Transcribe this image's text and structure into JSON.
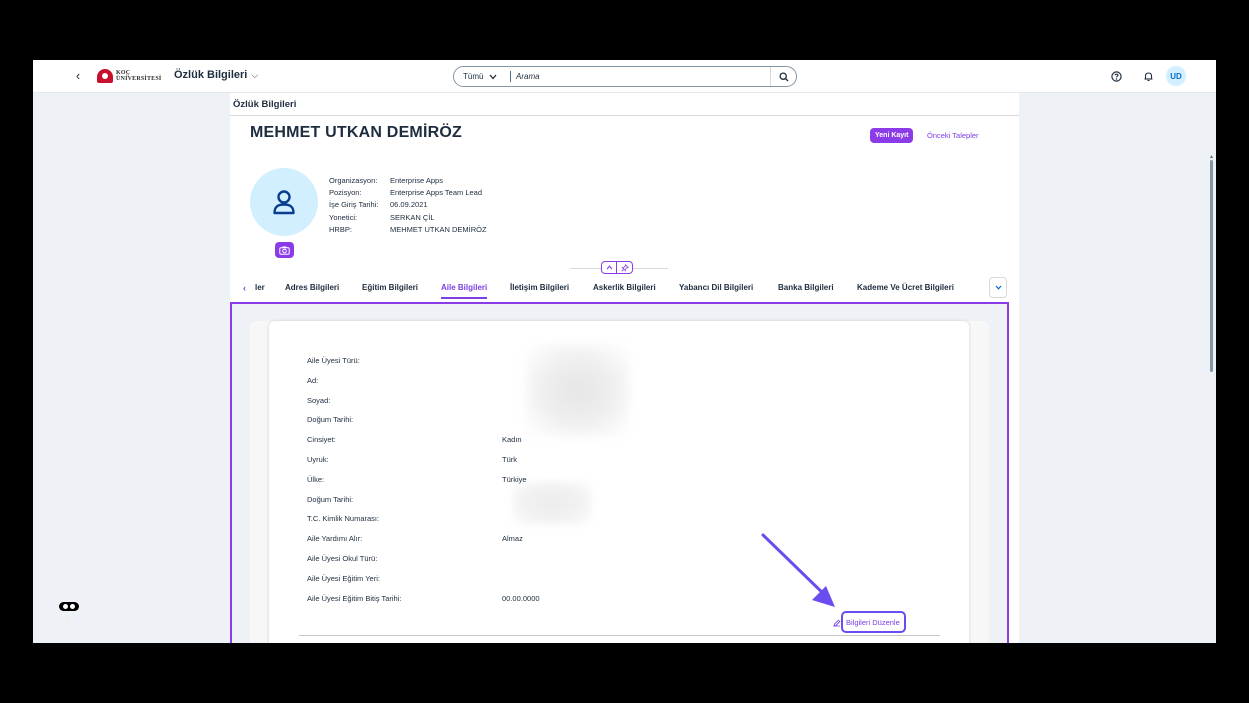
{
  "shell": {
    "back_glyph": "‹",
    "logo_line1": "KOÇ",
    "logo_line2": "ÜNİVERSİTESİ",
    "app_title": "Özlük Bilgileri",
    "search_scope": "Tümü",
    "search_placeholder": "Arama",
    "user_initials": "UD"
  },
  "page": {
    "title": "Özlük Bilgileri",
    "employee_name": "MEHMET UTKAN DEMİRÖZ",
    "new_record_label": "Yeni Kayıt",
    "previous_requests_label": "Önceki Talepler",
    "info": [
      {
        "label": "Organizasyon:",
        "value": "Enterprise Apps"
      },
      {
        "label": "Pozisyon:",
        "value": "Enterprise Apps Team Lead"
      },
      {
        "label": "İşe Giriş Tarihi:",
        "value": "06.09.2021"
      },
      {
        "label": "Yonetici:",
        "value": "SERKAN ÇİL"
      },
      {
        "label": "HRBP:",
        "value": "MEHMET UTKAN DEMİRÖZ"
      }
    ]
  },
  "tabs": {
    "truncated_first": "ler",
    "items": [
      "Adres Bilgileri",
      "Eğitim Bilgileri",
      "Aile Bilgileri",
      "İletişim Bilgileri",
      "Askerlik Bilgileri",
      "Yabancı Dil Bilgileri",
      "Banka Bilgileri",
      "Kademe Ve Ücret Bilgileri"
    ],
    "active": "Aile Bilgileri"
  },
  "family": {
    "fields": [
      {
        "label": "Aile Üyesi Türü:",
        "value": ""
      },
      {
        "label": "Ad:",
        "value": ""
      },
      {
        "label": "Soyad:",
        "value": ""
      },
      {
        "label": "Doğum Tarihi:",
        "value": ""
      },
      {
        "label": "Cinsiyet:",
        "value": "Kadın"
      },
      {
        "label": "Uyruk:",
        "value": "Türk"
      },
      {
        "label": "Ülke:",
        "value": "Türkiye"
      },
      {
        "label": "Doğum Tarihi:",
        "value": ""
      },
      {
        "label": "T.C. Kimlik Numarası:",
        "value": ""
      },
      {
        "label": "Aile Yardımı Alır:",
        "value": "Almaz"
      },
      {
        "label": "Aile Üyesi Okul Türü:",
        "value": ""
      },
      {
        "label": "Aile Üyesi Eğitim Yeri:",
        "value": ""
      },
      {
        "label": "Aile Üyesi Eğitim Bitiş Tarihi:",
        "value": "00.00.0000"
      }
    ],
    "edit_label": "Bilgileri Düzenle"
  },
  "colors": {
    "accent": "#8b3ce8",
    "arrow": "#6b4cf0"
  }
}
